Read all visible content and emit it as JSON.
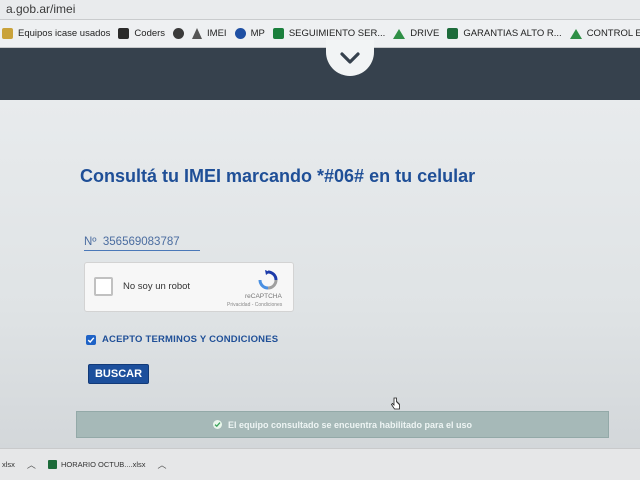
{
  "browser": {
    "url": "a.gob.ar/imei",
    "bookmarks": [
      {
        "label": "Equipos icase usados",
        "icon": "folder-icon"
      },
      {
        "label": "Coders",
        "icon": "coders-icon"
      },
      {
        "label": "",
        "icon": "globe-icon"
      },
      {
        "label": "IMEI",
        "icon": "ethereum-icon"
      },
      {
        "label": "MP",
        "icon": "mercadopago-icon"
      },
      {
        "label": "SEGUIMIENTO SER...",
        "icon": "green-square-icon"
      },
      {
        "label": "DRIVE",
        "icon": "drive-icon"
      },
      {
        "label": "GARANTIAS ALTO R...",
        "icon": "excel-icon"
      },
      {
        "label": "CONTROL ENVIO R...",
        "icon": "drive-icon"
      }
    ]
  },
  "page": {
    "title": "Consultá tu IMEI marcando *#06# en tu celular",
    "imei_prefix": "Nº",
    "imei_value": "356569083787",
    "captcha": {
      "label": "No soy un robot",
      "brand": "reCAPTCHA",
      "links": "Privacidad - Condiciones"
    },
    "terms_label": "ACEPTO TERMINOS Y CONDICIONES",
    "terms_checked": true,
    "search_button": "BUSCAR",
    "result_message": "El equipo consultado se encuentra habilitado para el uso"
  },
  "downloads": {
    "left_label": "xlsx",
    "file_name": "HORARIO OCTUB....xlsx"
  },
  "colors": {
    "brand_blue": "#1f4f97",
    "nav_dark": "#36414d",
    "success_bg": "#a6b9b8"
  }
}
